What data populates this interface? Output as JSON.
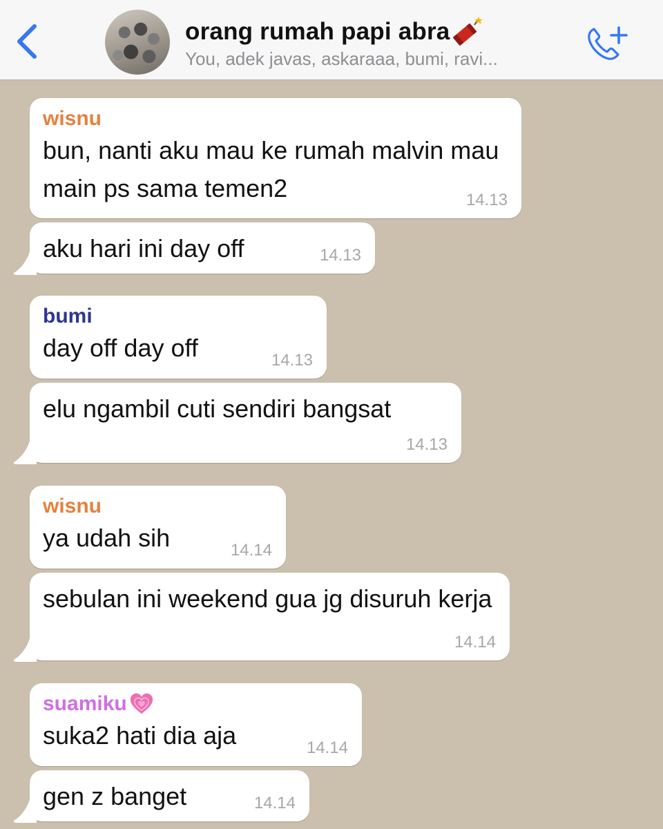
{
  "header": {
    "back_icon": "chevron-left-icon",
    "title": "orang rumah papi abra",
    "title_emoji": "firecracker-icon",
    "subtitle": "You, adek javas, askaraaa, bumi, ravi...",
    "call_icon": "add-call-icon",
    "accent_color": "#3478f6"
  },
  "messages": [
    {
      "sender": "wisnu",
      "sender_color": "#e5813e",
      "text": "bun, nanti aku mau ke rumah malvin mau main ps sama temen2",
      "time": "14.13"
    },
    {
      "text": "aku hari ini day off",
      "time": "14.13"
    },
    {
      "sender": "bumi",
      "sender_color": "#2d3592",
      "text": "day off day off",
      "time": "14.13"
    },
    {
      "text": "elu ngambil cuti sendiri bangsat",
      "time": "14.13"
    },
    {
      "sender": "wisnu",
      "sender_color": "#e5813e",
      "text": "ya udah sih",
      "time": "14.14"
    },
    {
      "text": "sebulan ini weekend gua jg disuruh kerja",
      "time": "14.14"
    },
    {
      "sender": "suamiku",
      "sender_emoji": "growing-heart-icon",
      "sender_color": "#d06ee2",
      "text": "suka2 hati dia aja",
      "time": "14.14"
    },
    {
      "text": "gen z banget",
      "time": "14.14"
    }
  ]
}
